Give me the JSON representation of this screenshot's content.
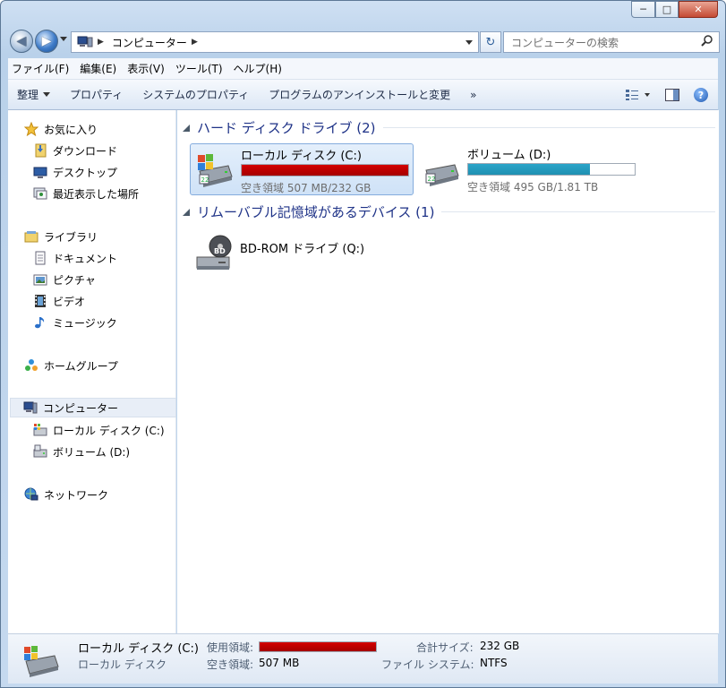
{
  "window": {
    "controls": {
      "min": "─",
      "max": "□",
      "close": "✕"
    }
  },
  "address": {
    "path": "コンピューター",
    "search_placeholder": "コンピューターの検索"
  },
  "menu": [
    "ファイル(F)",
    "編集(E)",
    "表示(V)",
    "ツール(T)",
    "ヘルプ(H)"
  ],
  "toolbar": {
    "organize": "整理",
    "properties": "プロパティ",
    "system_properties": "システムのプロパティ",
    "uninstall": "プログラムのアンインストールと変更",
    "more": "»"
  },
  "sidebar": {
    "favorites": "お気に入り",
    "downloads": "ダウンロード",
    "desktop": "デスクトップ",
    "recent": "最近表示した場所",
    "libraries": "ライブラリ",
    "documents": "ドキュメント",
    "pictures": "ピクチャ",
    "videos": "ビデオ",
    "music": "ミュージック",
    "homegroup": "ホームグループ",
    "computer": "コンピューター",
    "local_disk": "ローカル ディスク (C:)",
    "volume_d": "ボリューム (D:)",
    "network": "ネットワーク"
  },
  "groups": {
    "hdd": "ハード ディスク ドライブ (2)",
    "removable": "リムーバブル記憶域があるデバイス (1)"
  },
  "drives": {
    "c": {
      "name": "ローカル ディスク (C:)",
      "free": "空き領域 507 MB/232 GB",
      "used_fraction": 0.998
    },
    "d": {
      "name": "ボリューム (D:)",
      "free": "空き領域 495 GB/1.81 TB",
      "used_fraction": 0.73
    },
    "bd": {
      "name": "BD-ROM ドライブ (Q:)",
      "badge": "BD"
    }
  },
  "status": {
    "name": "ローカル ディスク (C:)",
    "type": "ローカル ディスク",
    "used_label": "使用領域:",
    "free_label": "空き領域:",
    "free_value": "507 MB",
    "total_label": "合計サイズ:",
    "total_value": "232 GB",
    "fs_label": "ファイル システム:",
    "fs_value": "NTFS"
  },
  "colors": {
    "bar_red": "#d40000",
    "bar_blue": "#1f8fb1",
    "group_heading": "#1e3287"
  }
}
